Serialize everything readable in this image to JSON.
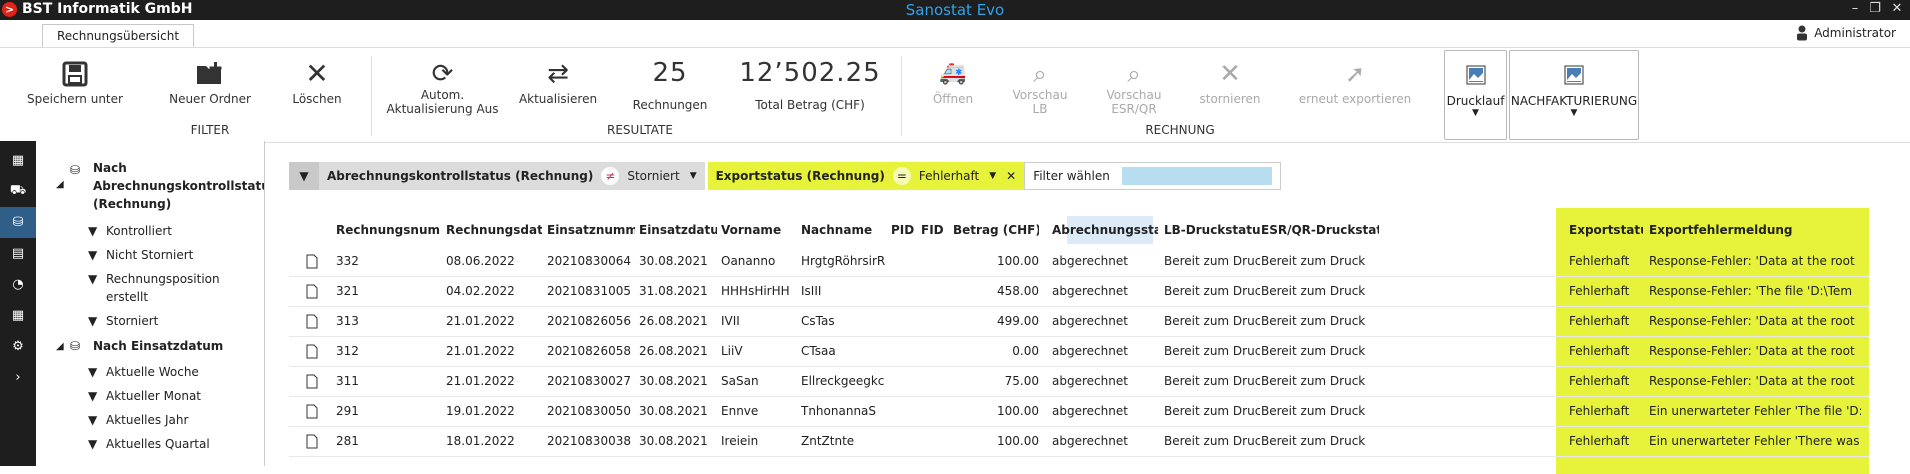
{
  "window": {
    "company": "BST Informatik GmbH",
    "app_title": "Sanostat Evo",
    "logo_letter": ">"
  },
  "tab": {
    "label": "Rechnungsübersicht"
  },
  "user": {
    "name": "Administrator"
  },
  "ribbon": {
    "save_label": "Speichern unter",
    "new_folder_label": "Neuer Ordner",
    "delete_label": "Löschen",
    "filter_group": "FILTER",
    "auto_update_label": "Autom.\nAktualisierung Aus",
    "refresh_label": "Aktualisieren",
    "invoice_count": "25",
    "invoice_count_label": "Rechnungen",
    "total_amount": "12’502.25",
    "total_label": "Total Betrag (CHF)",
    "results_group": "RESULTATE",
    "open_label": "Öffnen",
    "preview_lb_label": "Vorschau\nLB",
    "preview_esr_label": "Vorschau\nESR/QR",
    "cancel_label": "stornieren",
    "reexport_label": "erneut exportieren",
    "invoice_group": "RECHNUNG",
    "drucklauf_label": "Drucklauf",
    "nachfakt_label": "NACHFAKTURIERUNG"
  },
  "tree": {
    "group1": "Nach Abrechnungskontrollstatus (Rechnung)",
    "items1": [
      "Kontrolliert",
      "Nicht Storniert",
      "Rechnungsposition erstellt",
      "Storniert"
    ],
    "group2": "Nach Einsatzdatum",
    "items2": [
      "Aktuelle Woche",
      "Aktueller Monat",
      "Aktuelles Jahr",
      "Aktuelles Quartal"
    ]
  },
  "filters": {
    "f1_field": "Abrechnungskontrollstatus (Rechnung)",
    "f1_op": "≠",
    "f1_value": "Storniert",
    "f2_field": "Exportstatus (Rechnung)",
    "f2_op": "=",
    "f2_value": "Fehlerhaft",
    "choose": "Filter wählen"
  },
  "table": {
    "headers": [
      "Rechnungsnummer",
      "Rechnungsdatum",
      "Einsatznummer",
      "Einsatzdatum",
      "Vorname",
      "Nachname",
      "PID",
      "FID",
      "Betrag (CHF)",
      "Abrechnungsstatus",
      "LB-Druckstatus",
      "ESR/QR-Druckstatus",
      "Exportstatus",
      "Exportfehlermeldung"
    ],
    "rows": [
      [
        "332",
        "08.06.2022",
        "20210830064",
        "30.08.2021",
        "Oananno",
        "HrgtgRöhrsirR",
        "",
        "",
        "100.00",
        "abgerechnet",
        "Bereit zum Druck",
        "Bereit zum Druck",
        "Fehlerhaft",
        "Response-Fehler: 'Data at the root"
      ],
      [
        "321",
        "04.02.2022",
        "20210831005",
        "31.08.2021",
        "HHHsHirHH",
        "IsIII",
        "",
        "",
        "458.00",
        "abgerechnet",
        "Bereit zum Druck",
        "Bereit zum Druck",
        "Fehlerhaft",
        "Response-Fehler: 'The file 'D:\\Tem"
      ],
      [
        "313",
        "21.01.2022",
        "20210826056",
        "26.08.2021",
        "IVII",
        "CsTas",
        "",
        "",
        "499.00",
        "abgerechnet",
        "Bereit zum Druck",
        "Bereit zum Druck",
        "Fehlerhaft",
        "Response-Fehler: 'Data at the root"
      ],
      [
        "312",
        "21.01.2022",
        "20210826058",
        "26.08.2021",
        "LiiV",
        "CTsaa",
        "",
        "",
        "0.00",
        "abgerechnet",
        "Bereit zum Druck",
        "Bereit zum Druck",
        "Fehlerhaft",
        "Response-Fehler: 'Data at the root"
      ],
      [
        "311",
        "21.01.2022",
        "20210830027",
        "30.08.2021",
        "SaSan",
        "Ellreckgeegkc",
        "",
        "",
        "75.00",
        "abgerechnet",
        "Bereit zum Druck",
        "Bereit zum Druck",
        "Fehlerhaft",
        "Response-Fehler: 'Data at the root"
      ],
      [
        "291",
        "19.01.2022",
        "20210830050",
        "30.08.2021",
        "Ennve",
        "TnhonannaS",
        "",
        "",
        "100.00",
        "abgerechnet",
        "Bereit zum Druck",
        "Bereit zum Druck",
        "Fehlerhaft",
        "Ein unerwarteter Fehler 'The file 'D:"
      ],
      [
        "281",
        "18.01.2022",
        "20210830038",
        "30.08.2021",
        "Ireiein",
        "ZntZtnte",
        "",
        "",
        "100.00",
        "abgerechnet",
        "Bereit zum Druck",
        "Bereit zum Druck",
        "Fehlerhaft",
        "Ein unerwarteter Fehler 'There was"
      ]
    ]
  },
  "colors": {
    "highlight": "#e6f33a",
    "accent": "#2fa4e7",
    "dark": "#1e1e1e"
  }
}
